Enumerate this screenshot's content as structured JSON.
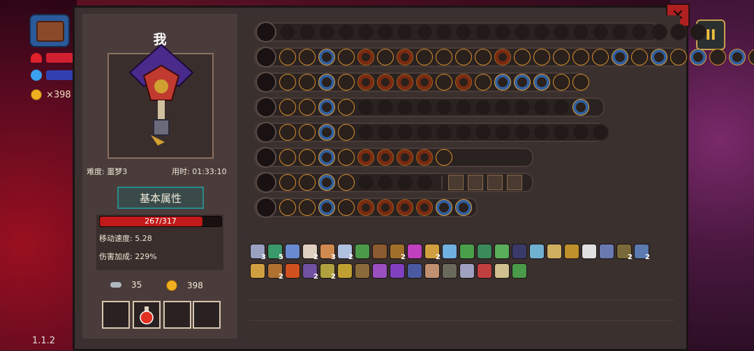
{
  "hud": {
    "coin_count": "×398",
    "version": "1.1.2",
    "pause_label": "II"
  },
  "panel": {
    "close_label": "✕",
    "character_name": "我",
    "difficulty": "难度: 噩梦3",
    "time_used": "用时: 01:33:10",
    "attr_tab": "基本属性",
    "hp": "267/317",
    "hp_fraction": 0.842,
    "move_speed": "移动速度: 5.28",
    "damage_bonus": "伤害加成: 229%",
    "keys": "35",
    "coins": "398"
  },
  "weapons": [
    {
      "icon": "chest-icon",
      "slots": "eeeeeeeeeeeeeeeeeeeeee"
    },
    {
      "icon": "staff-icon",
      "slots": "ffbfrfrffffrfffffbfbfbfbfb"
    },
    {
      "icon": "wand-icon",
      "slots": "ffbfrrrrfrfbbbff"
    },
    {
      "icon": "star-staff-icon",
      "slots": "ffbfeeeeeeeeeeeb"
    },
    {
      "icon": "leaf-staff-icon",
      "slots": "ffbfeeeeeeeeeeeee"
    },
    {
      "icon": "void-staff-icon",
      "slots": "ffbfrrrrf"
    },
    {
      "icon": "rod-icon",
      "slots": "ffbfeeee",
      "extra_squares": 4
    },
    {
      "icon": "scepter-icon",
      "slots": "ffbfrrrrbb"
    }
  ],
  "items": {
    "counts": [
      "3",
      "5",
      "2",
      "3",
      "2",
      "2",
      "2",
      "2",
      "2",
      "2",
      "2",
      "2"
    ]
  }
}
